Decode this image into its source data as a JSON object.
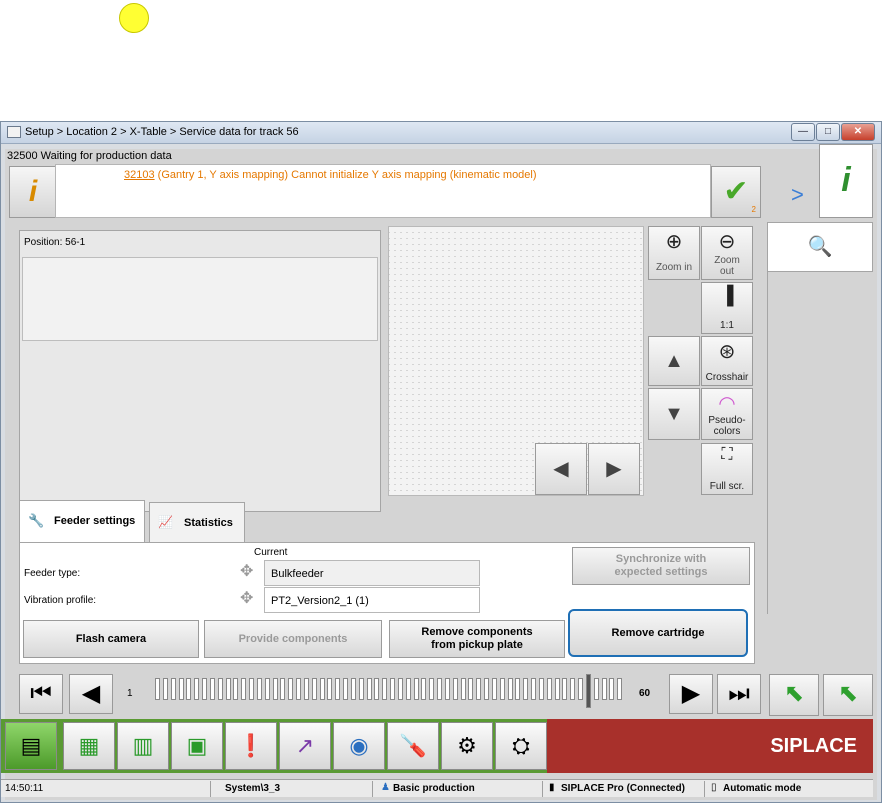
{
  "window": {
    "title": "Setup > Location 2 > X-Table > Service data for track 56",
    "minimize": "—",
    "maximize": "□",
    "close": "✕"
  },
  "status": {
    "top_message": "32500 Waiting for production data",
    "error_code": "32103",
    "error_text": "(Gantry 1, Y axis mapping) Cannot initialize Y axis mapping (kinematic model)",
    "confirm_badge": "2"
  },
  "position_panel": {
    "label": "Position: 56-1"
  },
  "view_controls": {
    "zoom_in": "Zoom in",
    "zoom_out": "Zoom\nout",
    "one_to_one": "1:1",
    "crosshair": "Crosshair",
    "pseudo_colors": "Pseudo-\ncolors",
    "full_screen": "Full scr."
  },
  "tabs": [
    {
      "label": "Feeder settings",
      "active": true
    },
    {
      "label": "Statistics",
      "active": false
    }
  ],
  "feeder_settings": {
    "current_header": "Current",
    "feeder_type_label": "Feeder type:",
    "feeder_type_value": "Bulkfeeder",
    "vibration_label": "Vibration profile:",
    "vibration_value": "PT2_Version2_1 (1)",
    "sync_button": "Synchronize with expected settings"
  },
  "actions": {
    "flash_camera": "Flash camera",
    "provide_components": "Provide components",
    "remove_components": "Remove components from pickup plate",
    "remove_cartridge": "Remove cartridge"
  },
  "track": {
    "start": "1",
    "end": "60"
  },
  "brand": "SIPLACE",
  "statusbar": {
    "time": "14:50:11",
    "system": "System\\3_3",
    "user_mode": "Basic production",
    "connection": "SIPLACE Pro (Connected)",
    "mode": "Automatic mode"
  },
  "colors": {
    "accent_orange": "#e57800",
    "highlight_blue": "#1f6fb5",
    "brand_red": "#a8302b",
    "bottom_green": "#5a9a33"
  }
}
